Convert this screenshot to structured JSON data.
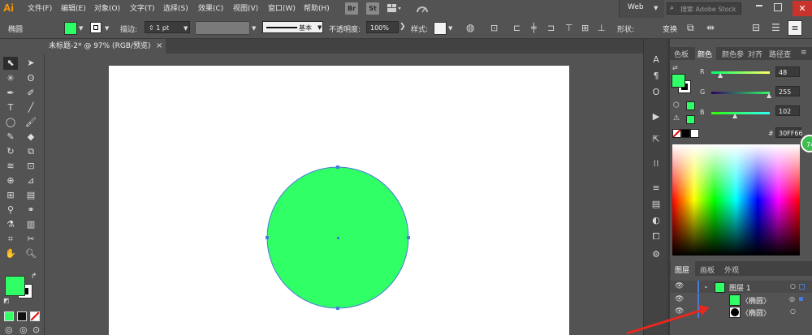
{
  "app": {
    "logo": "Ai"
  },
  "menu": {
    "items": [
      "文件(F)",
      "编辑(E)",
      "对象(O)",
      "文字(T)",
      "选择(S)",
      "效果(C)",
      "视图(V)",
      "窗口(W)",
      "帮助(H)"
    ],
    "bridge": "Br",
    "stock": "St",
    "workspace": "Web",
    "search_placeholder": "搜索 Adobe Stock"
  },
  "control": {
    "object_type": "椭圆",
    "stroke_label": "描边:",
    "stroke_weight": "1 pt",
    "stroke_style": "基本",
    "opacity_label": "不透明度:",
    "opacity_value": "100%",
    "style_label": "样式:",
    "shape_label": "形状:",
    "transform_label": "变换",
    "fill_color": "#2cff66"
  },
  "document": {
    "tab_title": "未标题-2* @ 97% (RGB/预览)",
    "close": "×"
  },
  "canvas": {
    "circle_color": "#30ff66",
    "stroke_color": "#4a7bd8"
  },
  "color_panel": {
    "tabs": [
      "色板",
      "颜色",
      "颜色参",
      "对齐",
      "路径查"
    ],
    "active_tab": "颜色",
    "r_label": "R",
    "r_value": "48",
    "g_label": "G",
    "g_value": "255",
    "b_label": "B",
    "b_value": "102",
    "hex_label": "#",
    "hex_value": "30FF66",
    "badge": "74"
  },
  "layers_panel": {
    "tabs": [
      "图层",
      "画板",
      "外观"
    ],
    "active_tab": "图层",
    "rows": [
      {
        "name": "图层 1"
      },
      {
        "name": "〈椭圆〉"
      },
      {
        "name": "〈椭圆〉"
      }
    ]
  }
}
